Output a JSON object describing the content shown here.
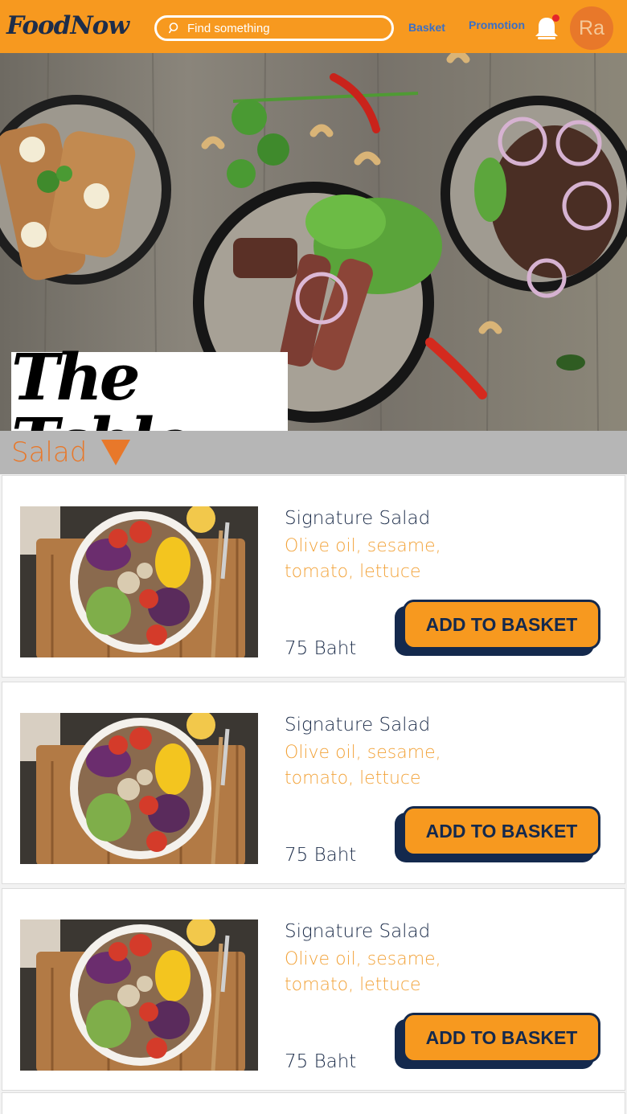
{
  "header": {
    "logo": "FoodNow",
    "search_placeholder": "Find something",
    "nav": {
      "basket": "Basket",
      "promotion": "Promotion"
    },
    "avatar_initials": "Ra",
    "notification_dot": true
  },
  "hero": {
    "brand_title": "The Table"
  },
  "category": {
    "label": "Salad"
  },
  "items": [
    {
      "name": "Signature Salad",
      "description": "Olive oil, sesame, tomato, lettuce",
      "price": "75 Baht",
      "button": "ADD TO BASKET"
    },
    {
      "name": "Signature Salad",
      "description": "Olive oil, sesame, tomato, lettuce",
      "price": "75 Baht",
      "button": "ADD TO BASKET"
    },
    {
      "name": "Signature Salad",
      "description": "Olive oil, sesame, tomato, lettuce",
      "price": "75 Baht",
      "button": "ADD TO BASKET"
    }
  ],
  "colors": {
    "accent": "#f7991f",
    "navy": "#14294d",
    "category_text": "#e8782a",
    "link": "#3a6fc5"
  },
  "icons": {
    "search": "search-icon",
    "bell": "bell-icon",
    "dropdown": "triangle-down-icon"
  }
}
